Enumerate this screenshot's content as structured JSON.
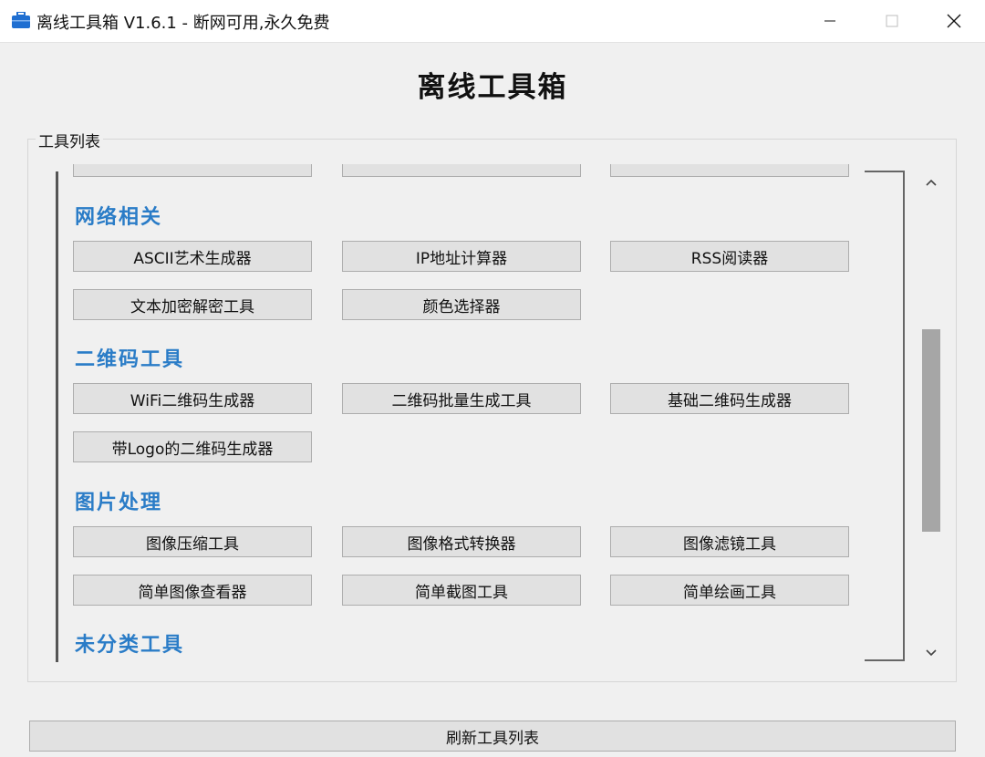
{
  "window": {
    "title": "离线工具箱 V1.6.1 - 断网可用,永久免费",
    "icon": "toolbox-icon",
    "controls": [
      "minimize-icon",
      "maximize-icon",
      "close-icon"
    ]
  },
  "header": {
    "title": "离线工具箱"
  },
  "tool_list": {
    "group_label": "工具列表",
    "categories": [
      {
        "name": "网络相关",
        "tools": [
          "ASCII艺术生成器",
          "IP地址计算器",
          "RSS阅读器",
          "文本加密解密工具",
          "颜色选择器"
        ]
      },
      {
        "name": "二维码工具",
        "tools": [
          "WiFi二维码生成器",
          "二维码批量生成工具",
          "基础二维码生成器",
          "带Logo的二维码生成器"
        ]
      },
      {
        "name": "图片处理",
        "tools": [
          "图像压缩工具",
          "图像格式转换器",
          "图像滤镜工具",
          "简单图像查看器",
          "简单截图工具",
          "简单绘画工具"
        ]
      },
      {
        "name": "未分类工具",
        "tools": []
      }
    ]
  },
  "footer": {
    "refresh_label": "刷新工具列表"
  },
  "colors": {
    "category_heading": "#2a7cc7",
    "button_bg": "#e1e1e1",
    "window_bg": "#f0f0f0"
  }
}
